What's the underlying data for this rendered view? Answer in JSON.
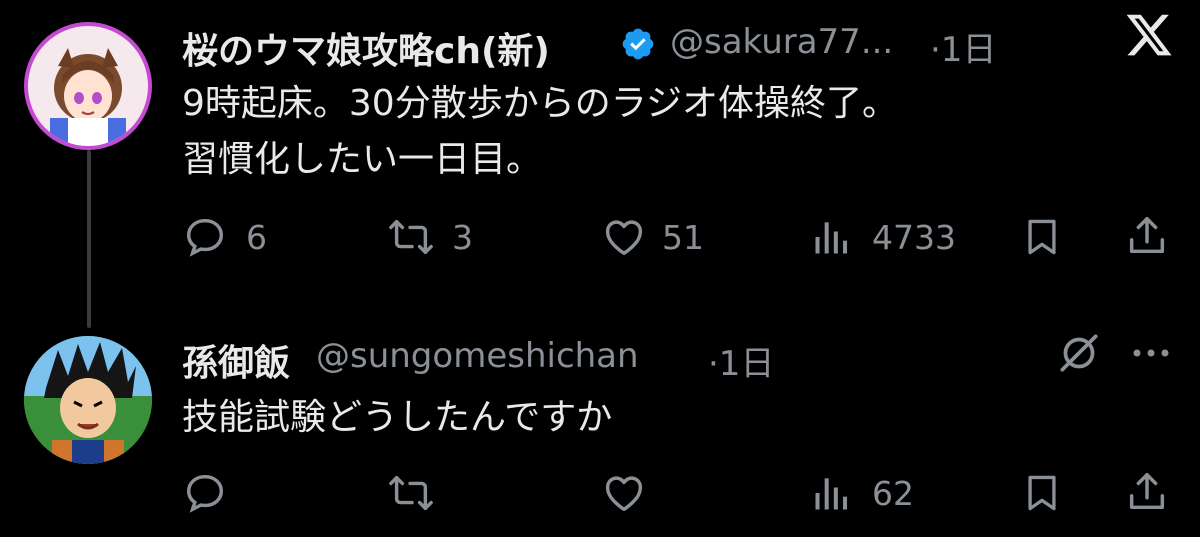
{
  "tweet1": {
    "display_name": "桜のウマ娘攻略ch(新)",
    "handle": "@sakura77...",
    "time": "·1日",
    "text_line1": "9時起床。30分散歩からのラジオ体操終了。",
    "text_line2": "習慣化したい一日目。",
    "replies": "6",
    "retweets": "3",
    "likes": "51",
    "views": "4733"
  },
  "tweet2": {
    "display_name": "孫御飯",
    "handle": "@sungomeshichan",
    "time": "·1日",
    "text": "技能試験どうしたんですか",
    "views": "62"
  },
  "colors": {
    "background": "#000000",
    "text": "#e7e9ea",
    "muted": "#8b9096",
    "verified": "#1d9bf0"
  },
  "icons": [
    "x-logo-icon",
    "verified-badge-icon",
    "reply-icon",
    "retweet-icon",
    "like-icon",
    "views-icon",
    "bookmark-icon",
    "share-icon",
    "grok-icon",
    "more-icon"
  ]
}
